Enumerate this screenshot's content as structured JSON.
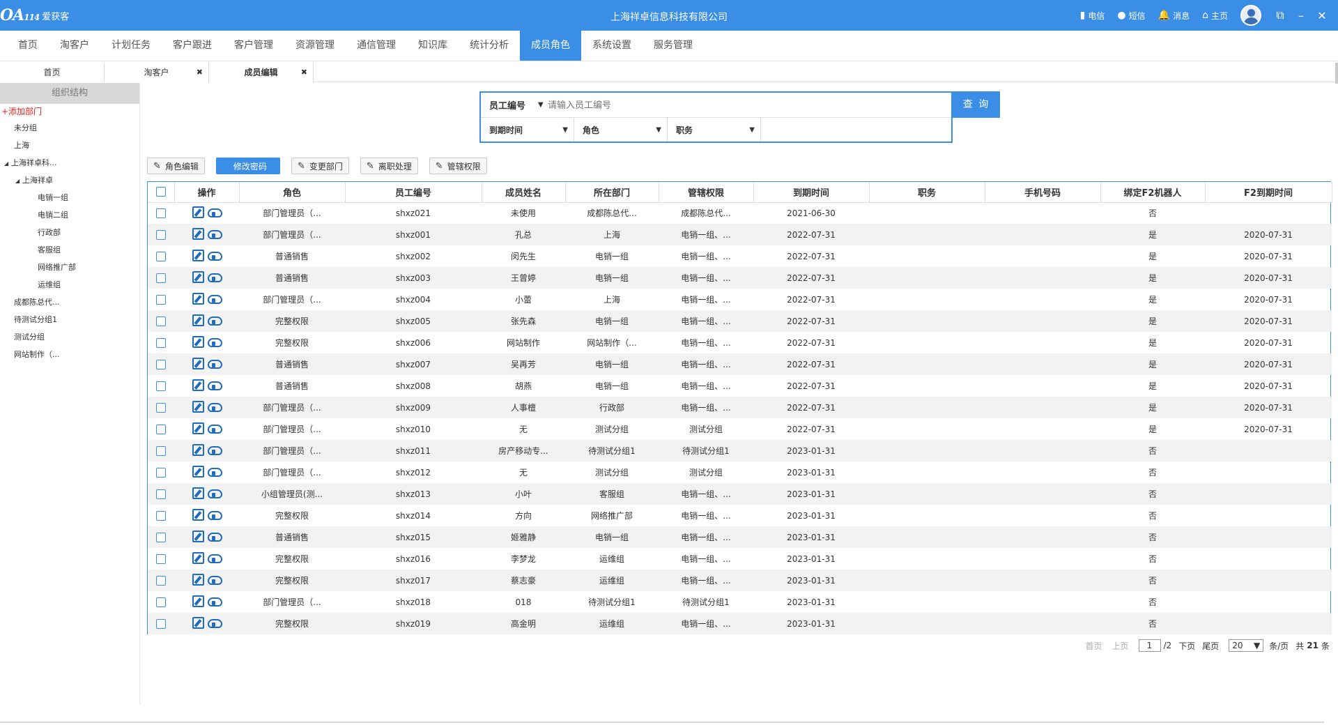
{
  "titlebar": {
    "logo_mark": "OA",
    "logo_sub": "114",
    "logo_text": "爱获客",
    "company": "上海祥卓信息科技有限公司",
    "items": [
      {
        "icon": "signal-icon",
        "glyph": "▮",
        "label": "电信"
      },
      {
        "icon": "chat-icon",
        "glyph": "●",
        "label": "短信"
      },
      {
        "icon": "bell-icon",
        "glyph": "🔔",
        "label": "消息"
      },
      {
        "icon": "home-icon",
        "glyph": "⌂",
        "label": "主页"
      }
    ],
    "window_buttons": [
      "⧉",
      "–",
      "✕"
    ]
  },
  "mainnav": [
    "首页",
    "淘客户",
    "计划任务",
    "客户跟进",
    "客户管理",
    "资源管理",
    "通信管理",
    "知识库",
    "统计分析",
    "成员角色",
    "系统设置",
    "服务管理"
  ],
  "mainnav_active": "成员角色",
  "tabs": [
    {
      "label": "首页",
      "closable": false
    },
    {
      "label": "淘客户",
      "closable": true
    },
    {
      "label": "成员编辑",
      "closable": true
    }
  ],
  "sidebar": {
    "header": "组织结构",
    "add_label": "+添加部门",
    "tree": [
      {
        "label": "未分组",
        "level": 0,
        "expanded": false
      },
      {
        "label": "上海",
        "level": 0,
        "expanded": false
      },
      {
        "label": "上海祥卓科...",
        "level": 0,
        "expanded": true
      },
      {
        "label": "上海祥卓",
        "level": 1,
        "expanded": true
      },
      {
        "label": "电销一组",
        "level": 2,
        "expanded": false
      },
      {
        "label": "电销二组",
        "level": 2,
        "expanded": false
      },
      {
        "label": "行政部",
        "level": 2,
        "expanded": false
      },
      {
        "label": "客服组",
        "level": 2,
        "expanded": false
      },
      {
        "label": "网络推广部",
        "level": 2,
        "expanded": false
      },
      {
        "label": "运维组",
        "level": 2,
        "expanded": false
      },
      {
        "label": "成都陈总代...",
        "level": 0,
        "expanded": false
      },
      {
        "label": "待测试分组1",
        "level": 0,
        "expanded": false
      },
      {
        "label": "测试分组",
        "level": 0,
        "expanded": false
      },
      {
        "label": "网站制作（...",
        "level": 0,
        "expanded": false
      }
    ]
  },
  "search": {
    "field_label": "员工编号",
    "placeholder": "请输入员工编号",
    "filters": [
      "到期时间",
      "角色",
      "职务"
    ],
    "button": "查 询"
  },
  "toolbar": [
    "角色编辑",
    "修改密码",
    "变更部门",
    "离职处理",
    "管辖权限"
  ],
  "toolbar_active": "修改密码",
  "table": {
    "columns": [
      "",
      "操作",
      "角色",
      "员工编号",
      "成员姓名",
      "所在部门",
      "管辖权限",
      "到期时间",
      "职务",
      "手机号码",
      "绑定F2机器人",
      "F2到期时间"
    ],
    "rows": [
      [
        "部门管理员（...",
        "shxz021",
        "未使用",
        "成都陈总代...",
        "成都陈总代...",
        "2021-06-30",
        "",
        "",
        "否",
        ""
      ],
      [
        "部门管理员（...",
        "shxz001",
        "孔总",
        "上海",
        "电销一组、...",
        "2022-07-31",
        "",
        "",
        "是",
        "2020-07-31"
      ],
      [
        "普通销售",
        "shxz002",
        "闵先生",
        "电销一组",
        "电销一组、...",
        "2022-07-31",
        "",
        "",
        "是",
        "2020-07-31"
      ],
      [
        "普通销售",
        "shxz003",
        "王曾婷",
        "电销一组",
        "电销一组、...",
        "2022-07-31",
        "",
        "",
        "是",
        "2020-07-31"
      ],
      [
        "部门管理员（...",
        "shxz004",
        "小蕾",
        "上海",
        "电销一组、...",
        "2022-07-31",
        "",
        "",
        "是",
        "2020-07-31"
      ],
      [
        "完整权限",
        "shxz005",
        "张先森",
        "电销一组",
        "电销一组、...",
        "2022-07-31",
        "",
        "",
        "是",
        "2020-07-31"
      ],
      [
        "完整权限",
        "shxz006",
        "网站制作",
        "网站制作（...",
        "电销一组、...",
        "2022-07-31",
        "",
        "",
        "是",
        "2020-07-31"
      ],
      [
        "普通销售",
        "shxz007",
        "吴再芳",
        "电销一组",
        "电销一组、...",
        "2022-07-31",
        "",
        "",
        "是",
        "2020-07-31"
      ],
      [
        "普通销售",
        "shxz008",
        "胡燕",
        "电销一组",
        "电销一组、...",
        "2022-07-31",
        "",
        "",
        "是",
        "2020-07-31"
      ],
      [
        "部门管理员（...",
        "shxz009",
        "人事檀",
        "行政部",
        "电销一组、...",
        "2022-07-31",
        "",
        "",
        "是",
        "2020-07-31"
      ],
      [
        "部门管理员（...",
        "shxz010",
        "无",
        "测试分组",
        "测试分组",
        "2022-07-31",
        "",
        "",
        "是",
        "2020-07-31"
      ],
      [
        "部门管理员（...",
        "shxz011",
        "房产移动专...",
        "待测试分组1",
        "待测试分组1",
        "2023-01-31",
        "",
        "",
        "否",
        ""
      ],
      [
        "部门管理员（...",
        "shxz012",
        "无",
        "测试分组",
        "测试分组",
        "2023-01-31",
        "",
        "",
        "否",
        ""
      ],
      [
        "小组管理员(测...",
        "shxz013",
        "小叶",
        "客服组",
        "电销一组、...",
        "2023-01-31",
        "",
        "",
        "否",
        ""
      ],
      [
        "完整权限",
        "shxz014",
        "方向",
        "网络推广部",
        "电销一组、...",
        "2023-01-31",
        "",
        "",
        "否",
        ""
      ],
      [
        "普通销售",
        "shxz015",
        "姬雅静",
        "电销一组",
        "电销一组、...",
        "2023-01-31",
        "",
        "",
        "否",
        ""
      ],
      [
        "完整权限",
        "shxz016",
        "李梦龙",
        "运维组",
        "电销一组、...",
        "2023-01-31",
        "",
        "",
        "否",
        ""
      ],
      [
        "完整权限",
        "shxz017",
        "蔡志豪",
        "运维组",
        "电销一组、...",
        "2023-01-31",
        "",
        "",
        "否",
        ""
      ],
      [
        "部门管理员（...",
        "shxz018",
        "018",
        "待测试分组1",
        "待测试分组1",
        "2023-01-31",
        "",
        "",
        "否",
        ""
      ],
      [
        "完整权限",
        "shxz019",
        "高金明",
        "运维组",
        "电销一组、...",
        "2023-01-31",
        "",
        "",
        "否",
        ""
      ]
    ]
  },
  "pager": {
    "first": "首页",
    "prev": "上页",
    "current": "1",
    "total_pages": "/2",
    "next": "下页",
    "last": "尾页",
    "page_size": "20",
    "per_page_label": "条/页",
    "total_prefix": "共",
    "total": "21",
    "total_suffix": "条"
  },
  "colors": {
    "accent": "#3a8ee6",
    "add_red": "#e2231a",
    "icon_blue": "#1e6bbf"
  }
}
